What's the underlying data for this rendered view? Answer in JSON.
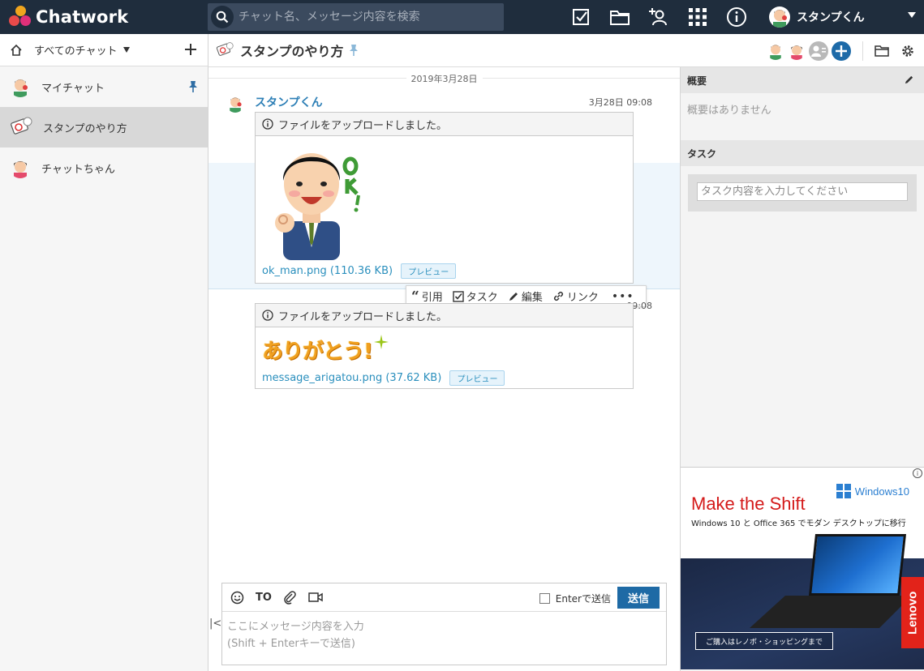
{
  "app": {
    "name": "Chatwork"
  },
  "header": {
    "search_placeholder": "チャット名、メッセージ内容を検索",
    "user_name": "スタンプくん"
  },
  "sidebar": {
    "filter_label": "すべてのチャット",
    "rooms": [
      {
        "name": "マイチャット",
        "pinned": true
      },
      {
        "name": "スタンプのやり方",
        "active": true
      },
      {
        "name": "チャットちゃん"
      }
    ]
  },
  "room": {
    "title": "スタンプのやり方",
    "date_divider": "2019年3月28日",
    "messages": [
      {
        "sender": "スタンプくん",
        "time": "3月28日 09:08",
        "notice": "ファイルをアップロードしました。",
        "file_name": "ok_man.png (110.36 KB)",
        "preview": "プレビュー"
      },
      {
        "time": "09:08",
        "notice": "ファイルをアップロードしました。",
        "file_name": "message_arigatou.png (37.62 KB)",
        "preview": "プレビュー",
        "sticker_text": "ありがとう!"
      }
    ],
    "actions": {
      "quote": "引用",
      "task": "タスク",
      "edit": "編集",
      "link": "リンク"
    }
  },
  "composer": {
    "to_label": "TO",
    "enter_send_label": "Enterで送信",
    "send_label": "送信",
    "placeholder": "ここにメッセージ内容を入力\n(Shift + Enterキーで送信)"
  },
  "right_panel": {
    "summary_title": "概要",
    "summary_empty": "概要はありません",
    "task_title": "タスク",
    "task_placeholder": "タスク内容を入力してください"
  },
  "ad": {
    "headline": "Make the Shift",
    "brand": "Windows10",
    "subline": "Windows 10 と Office 365 でモダン デスクトップに移行",
    "cta": "ご購入はレノボ・ショッピングまで",
    "vendor": "Lenovo"
  },
  "colors": {
    "topbar": "#1f2d3d",
    "accent_link": "#2a8fbd",
    "send_button": "#1e6aa5"
  }
}
